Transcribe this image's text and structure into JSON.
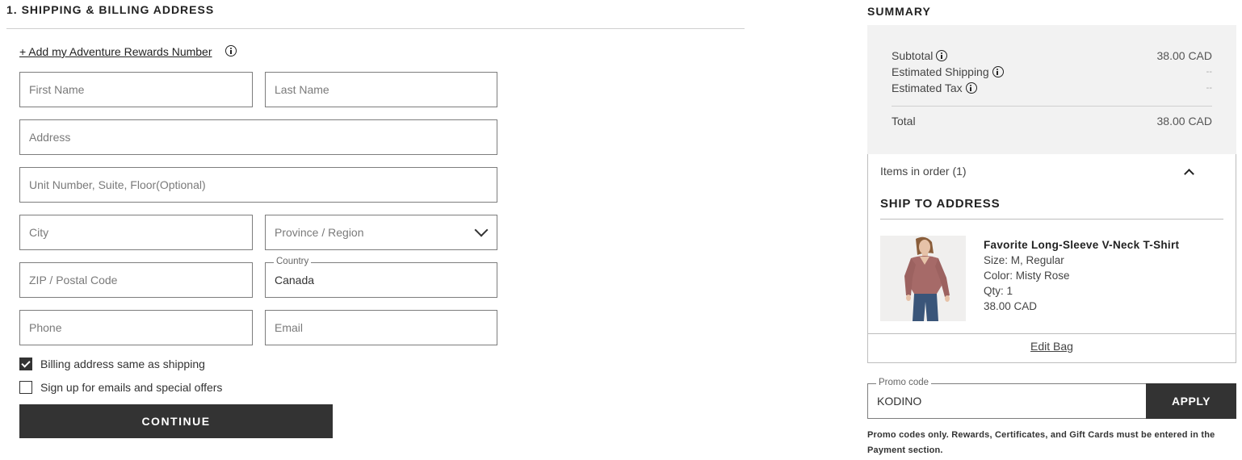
{
  "shipping": {
    "section_title": "1. SHIPPING & BILLING ADDRESS",
    "rewards_link": "+ Add my Adventure Rewards Number",
    "fields": {
      "first_name": {
        "placeholder": "First Name",
        "value": ""
      },
      "last_name": {
        "placeholder": "Last Name",
        "value": ""
      },
      "address": {
        "placeholder": "Address",
        "value": ""
      },
      "unit": {
        "placeholder": "Unit Number, Suite, Floor(Optional)",
        "value": ""
      },
      "city": {
        "placeholder": "City",
        "value": ""
      },
      "province": {
        "placeholder": "Province / Region"
      },
      "zip": {
        "placeholder": "ZIP / Postal Code",
        "value": ""
      },
      "country": {
        "label": "Country",
        "value": "Canada"
      },
      "phone": {
        "placeholder": "Phone",
        "value": ""
      },
      "email": {
        "placeholder": "Email",
        "value": ""
      }
    },
    "billing_same_label": "Billing address same as shipping",
    "billing_same_checked": true,
    "signup_label": "Sign up for emails and special offers",
    "signup_checked": false,
    "continue_label": "CONTINUE"
  },
  "summary": {
    "title": "SUMMARY",
    "subtotal_label": "Subtotal",
    "subtotal_value": "38.00 CAD",
    "shipping_label": "Estimated Shipping",
    "shipping_value": "--",
    "tax_label": "Estimated Tax",
    "tax_value": "--",
    "total_label": "Total",
    "total_value": "38.00 CAD",
    "items_label": "Items in order (1)",
    "ship_to_title": "SHIP TO ADDRESS",
    "product": {
      "name": "Favorite Long-Sleeve V-Neck T-Shirt",
      "size": "Size: M, Regular",
      "color": "Color: Misty Rose",
      "qty": "Qty: 1",
      "price": "38.00 CAD"
    },
    "edit_bag": "Edit Bag"
  },
  "promo": {
    "label": "Promo code",
    "value": "KODINO",
    "apply_label": "APPLY",
    "note": "Promo codes only. Rewards, Certificates, and Gift Cards must be entered in the Payment section."
  },
  "colors": {
    "button_dark": "#333333",
    "summary_bg": "#f2f2f2",
    "shirt": "#a66a68",
    "jeans": "#3a5579"
  }
}
